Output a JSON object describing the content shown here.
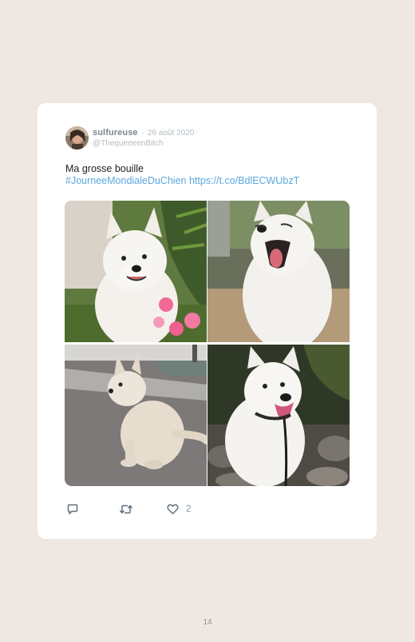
{
  "tweet": {
    "display_name": "sulfureuse",
    "separator": "·",
    "date": "26 août 2020",
    "handle": "@ThequeeeenBitch",
    "text_line1": "Ma grosse bouille",
    "hashtag": "#JourneeMondialeDuChien",
    "link": "https://t.co/BdlECWUbzT",
    "photos": [
      {
        "subject": "white samoyed dog smiling near pink flowers"
      },
      {
        "subject": "white samoyed dog yawning with tongue out"
      },
      {
        "subject": "white samoyed puppy sitting on pavement"
      },
      {
        "subject": "white samoyed dog sitting on rocks with leash"
      }
    ],
    "actions": {
      "reply_icon": "reply-icon",
      "retweet_icon": "retweet-icon",
      "like_icon": "heart-icon",
      "like_count": "2"
    }
  },
  "page": {
    "number": "14"
  },
  "colors": {
    "background": "#efe7e2",
    "card": "#ffffff",
    "link": "#5aa8dd",
    "name": "#7a8690",
    "muted": "#b3bcc3"
  }
}
